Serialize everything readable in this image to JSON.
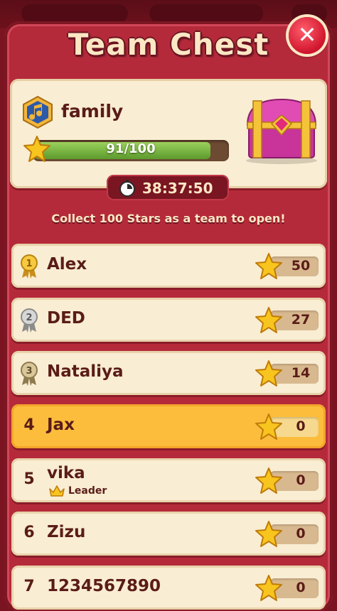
{
  "title": "Team Chest",
  "team": {
    "name": "family",
    "progress_text": "91/100",
    "progress_fraction": 0.91
  },
  "timer": "38:37:50",
  "goal": "Collect 100 Stars as a team to open!",
  "members": [
    {
      "rank": "1",
      "name": "Alex",
      "score": "50",
      "medal": "gold"
    },
    {
      "rank": "2",
      "name": "DED",
      "score": "27",
      "medal": "silver"
    },
    {
      "rank": "3",
      "name": "Nataliya",
      "score": "14",
      "medal": "bronze"
    },
    {
      "rank": "4",
      "name": "Jax",
      "score": "0",
      "highlighted": true
    },
    {
      "rank": "5",
      "name": "vika",
      "score": "0",
      "role": "Leader"
    },
    {
      "rank": "6",
      "name": "Zizu",
      "score": "0"
    },
    {
      "rank": "7",
      "name": "1234567890",
      "score": "0"
    }
  ],
  "colors": {
    "panel": "#b52a3a",
    "card": "#f9edd3",
    "highlight": "#fcbd3c",
    "text_dark": "#5a1c18",
    "title_text": "#fbe7c4"
  },
  "icons": [
    "close-icon",
    "music-note-badge-icon",
    "star-icon",
    "treasure-chest-icon",
    "stopwatch-icon",
    "medal-icon",
    "crown-icon"
  ]
}
